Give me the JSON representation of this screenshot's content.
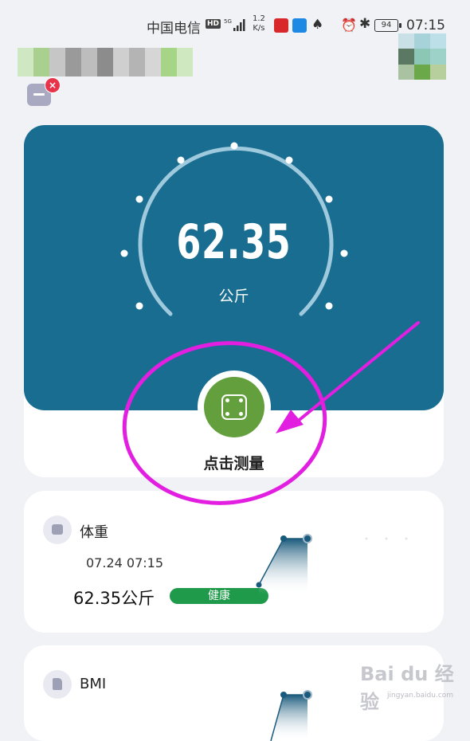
{
  "status_bar": {
    "carrier": "中国电信",
    "hd": "HD",
    "net_speed_value": "1.2",
    "net_speed_unit": "K/s",
    "battery": "94",
    "time": "07:15"
  },
  "main": {
    "weight_value": "62.35",
    "weight_unit": "公斤",
    "measure_label": "点击测量"
  },
  "weight_card": {
    "title": "体重",
    "datetime": "07.24 07:15",
    "value": "62.35公斤",
    "status": "健康"
  },
  "bmi_card": {
    "title": "BMI"
  },
  "watermark": {
    "brand": "Bai du 经验",
    "domain": "jingyan.baidu.com"
  },
  "colors": {
    "gauge_bg": "#186d91",
    "measure_green": "#63a03d",
    "health_green": "#1f9a4a",
    "annotation_magenta": "#e21fe0"
  }
}
